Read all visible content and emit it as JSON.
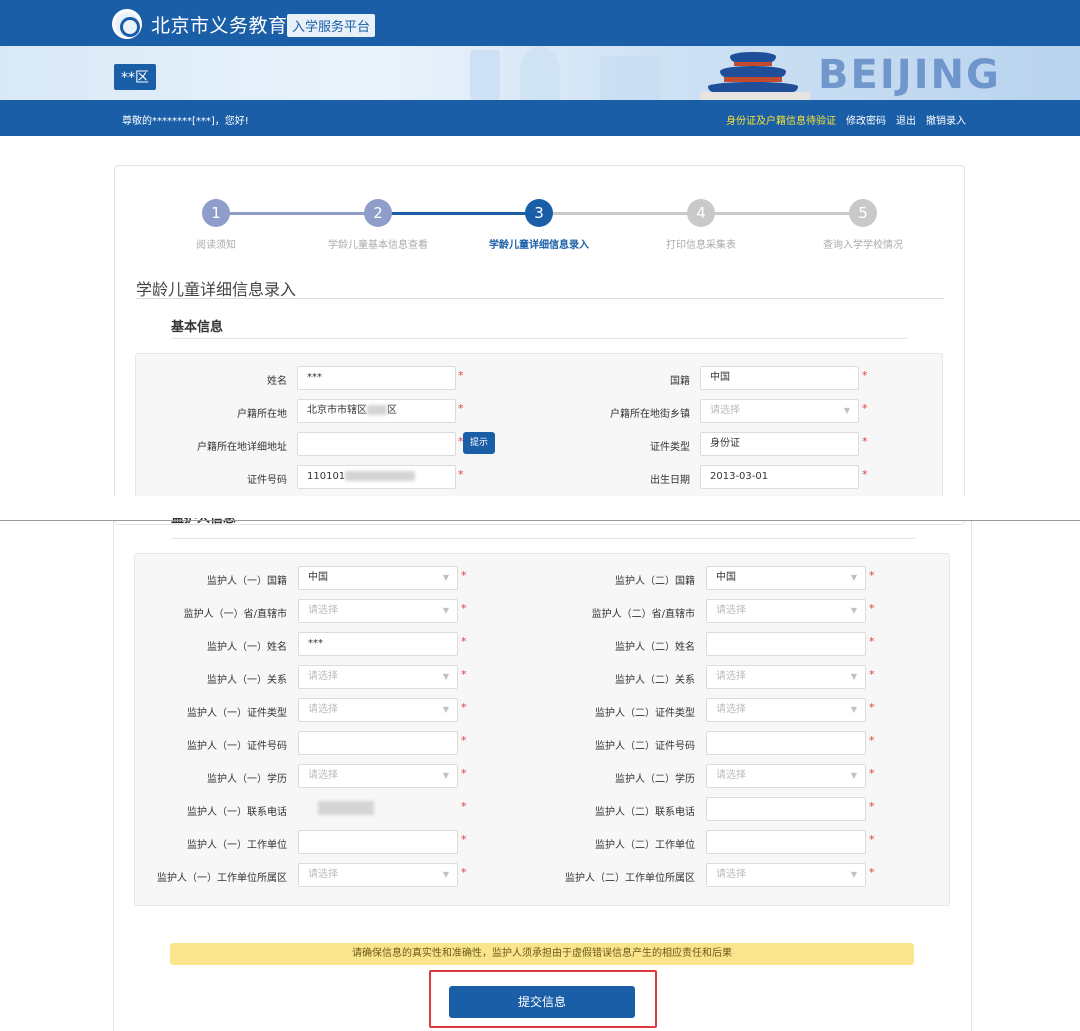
{
  "header": {
    "logo_icon": "beijing-education-logo-icon",
    "brand_title": "北京市义务教育",
    "brand_subtitle": "入学服务平台",
    "district_badge": "**区",
    "banner_word": "BEIJING",
    "greeting": "尊敬的********[***]，您好!",
    "links": {
      "id_pending": "身份证及户籍信息待验证",
      "change_password": "修改密码",
      "logout": "退出",
      "cancel_entry": "撤销录入"
    },
    "colors": {
      "primary": "#1a5ea8",
      "link_highlight": "#f5e23a"
    }
  },
  "steps": {
    "current": 3,
    "items": [
      {
        "num": "1",
        "label": "阅读须知"
      },
      {
        "num": "2",
        "label": "学龄儿童基本信息查看"
      },
      {
        "num": "3",
        "label": "学龄儿童详细信息录入"
      },
      {
        "num": "4",
        "label": "打印信息采集表"
      },
      {
        "num": "5",
        "label": "查询入学学校情况"
      }
    ]
  },
  "form": {
    "title": "学龄儿童详细信息录入",
    "basic_section": "基本信息",
    "basic": {
      "name_label": "姓名",
      "name_value": "***",
      "nationality_label": "国籍",
      "nationality_value": "中国",
      "hukou_label": "户籍所在地",
      "hukou_value_prefix": "北京市市辖区",
      "hukou_value_suffix": "区",
      "street_label": "户籍所在地街乡镇",
      "street_placeholder": "请选择",
      "address_label": "户籍所在地详细地址",
      "address_value": "",
      "tip_button": "提示",
      "id_type_label": "证件类型",
      "id_type_value": "身份证",
      "id_number_label": "证件号码",
      "id_number_prefix": "110101",
      "birthdate_label": "出生日期",
      "birthdate_value": "2013-03-01"
    },
    "guardian_section": "监护人信息",
    "guardian1": {
      "nationality_label": "监护人（一）国籍",
      "nationality_value": "中国",
      "province_label": "监护人（一）省/直辖市",
      "province_placeholder": "请选择",
      "name_label": "监护人（一）姓名",
      "name_value": "***",
      "relation_label": "监护人（一）关系",
      "relation_placeholder": "请选择",
      "id_type_label": "监护人（一）证件类型",
      "id_type_placeholder": "请选择",
      "id_number_label": "监护人（一）证件号码",
      "id_number_value": "",
      "education_label": "监护人（一）学历",
      "education_placeholder": "请选择",
      "phone_label": "监护人（一）联系电话",
      "employer_label": "监护人（一）工作单位",
      "employer_value": "",
      "employer_district_label": "监护人（一）工作单位所属区",
      "employer_district_placeholder": "请选择"
    },
    "guardian2": {
      "nationality_label": "监护人（二）国籍",
      "nationality_value": "中国",
      "province_label": "监护人（二）省/直辖市",
      "province_placeholder": "请选择",
      "name_label": "监护人（二）姓名",
      "name_value": "",
      "relation_label": "监护人（二）关系",
      "relation_placeholder": "请选择",
      "id_type_label": "监护人（二）证件类型",
      "id_type_placeholder": "请选择",
      "id_number_label": "监护人（二）证件号码",
      "id_number_value": "",
      "education_label": "监护人（二）学历",
      "education_placeholder": "请选择",
      "phone_label": "监护人（二）联系电话",
      "phone_value": "",
      "employer_label": "监护人（二）工作单位",
      "employer_value": "",
      "employer_district_label": "监护人（二）工作单位所属区",
      "employer_district_placeholder": "请选择"
    },
    "required_mark": "*",
    "dropdown_caret": "▼",
    "notice": "请确保信息的真实性和准确性，监护人须承担由于虚假错误信息产生的相应责任和后果",
    "submit_label": "提交信息",
    "colors": {
      "required": "#e04040",
      "notice_bg": "#fbe58c",
      "highlight_border": "#e0393e"
    }
  }
}
